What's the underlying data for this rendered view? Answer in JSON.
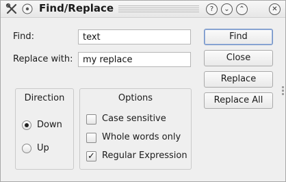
{
  "window": {
    "title": "Find/Replace",
    "app_icon": "tools-icon",
    "title_buttons": [
      "help-icon",
      "minimize-icon",
      "maximize-icon"
    ]
  },
  "find": {
    "label": "Find:",
    "value": "text"
  },
  "replace": {
    "label": "Replace with:",
    "value": "my replace"
  },
  "buttons": {
    "find": "Find",
    "close": "Close",
    "replace": "Replace",
    "replace_all": "Replace All"
  },
  "direction": {
    "title": "Direction",
    "options": [
      {
        "label": "Down",
        "selected": true
      },
      {
        "label": "Up",
        "selected": false
      }
    ]
  },
  "options": {
    "title": "Options",
    "items": [
      {
        "label": "Case sensitive",
        "checked": false
      },
      {
        "label": "Whole words only",
        "checked": false
      },
      {
        "label": "Regular Expression",
        "checked": true
      }
    ]
  },
  "colors": {
    "background": "#efefef",
    "default_button_border": "#6f8fc4"
  }
}
